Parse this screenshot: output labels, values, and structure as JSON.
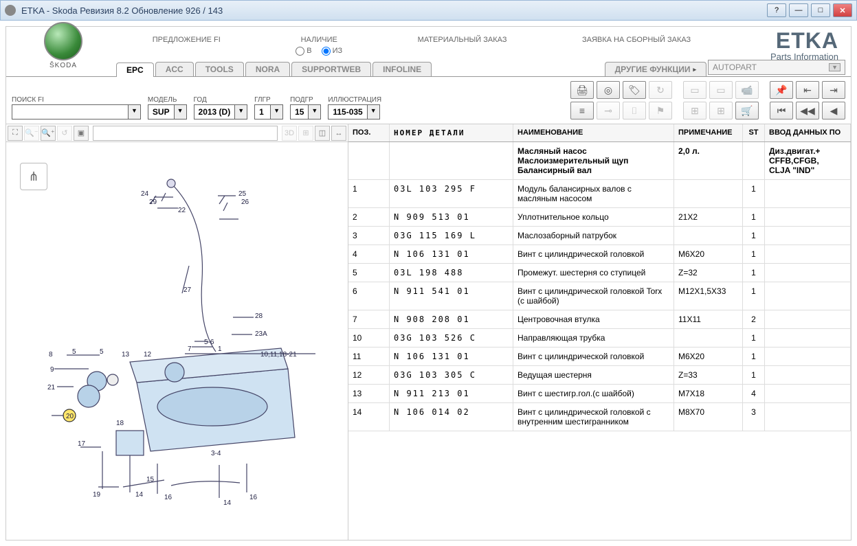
{
  "window": {
    "title": "ETKA - Skoda Ревизия 8.2 Обновление 926 / 143",
    "help": "?",
    "minimize": "—",
    "maximize": "□",
    "close": "✕"
  },
  "brand": {
    "label": "ŠKODA"
  },
  "topmenu": {
    "m1": "ПРЕДЛОЖЕНИЕ FI",
    "m2": "НАЛИЧИЕ",
    "m3": "МАТЕРИАЛЬНЫЙ ЗАКАЗ",
    "m4": "ЗАЯВКА НА СБОРНЫЙ ЗАКАЗ",
    "r1": "В",
    "r2": "ИЗ"
  },
  "etka": {
    "logo": "ETKA",
    "sub": "Parts Information"
  },
  "tabs": {
    "epc": "EPC",
    "acc": "ACC",
    "tools": "TOOLS",
    "nora": "NORA",
    "supportweb": "SUPPORTWEB",
    "infoline": "INFOLINE",
    "other": "ДРУГИЕ ФУНКЦИИ",
    "autopart": "AUTOPART"
  },
  "filters": {
    "search_lbl": "ПОИСК FI",
    "model_lbl": "МОДЕЛЬ",
    "model_val": "SUP",
    "year_lbl": "ГОД",
    "year_val": "2013 (D)",
    "gg_lbl": "ГЛГР",
    "gg_val": "1",
    "sg_lbl": "ПОДГР",
    "sg_val": "15",
    "ill_lbl": "ИЛЛЮСТРАЦИЯ",
    "ill_val": "115-035"
  },
  "imgtoolbar": {
    "threeD": "3D"
  },
  "columns": {
    "pos": "ПОЗ.",
    "num": "НОМЕР ДЕТАЛИ",
    "name": "НАИМЕНОВАНИЕ",
    "rem": "ПРИМЕЧАНИЕ",
    "st": "ST",
    "inp": "ВВОД ДАННЫХ ПО"
  },
  "headerrow": {
    "name": "Масляный насос\nМаслоизмерительный щуп\nБалансирный вал",
    "rem": "2,0 л.",
    "inp": "Диз.двигат.+\nCFFB,CFGB,\nCLJA \"IND\""
  },
  "rows": [
    {
      "pos": "1",
      "num": "03L 103 295 F",
      "name": "Модуль балансирных валов с масляным насосом",
      "rem": "",
      "st": "1"
    },
    {
      "pos": "2",
      "num": "N   909 513 01",
      "name": "Уплотнительное кольцо",
      "rem": "21X2",
      "st": "1"
    },
    {
      "pos": "3",
      "num": "03G 115 169 L",
      "name": "Маслозаборный патрубок",
      "rem": "",
      "st": "1"
    },
    {
      "pos": "4",
      "num": "N   106 131 01",
      "name": "Винт с цилиндрической головкой",
      "rem": "M6X20",
      "st": "1"
    },
    {
      "pos": "5",
      "num": "03L 198 488",
      "name": "Промежут. шестерня со ступицей",
      "rem": "Z=32",
      "st": "1"
    },
    {
      "pos": "6",
      "num": "N   911 541 01",
      "name": "Винт с цилиндрической головкой Torx (с шайбой)",
      "rem": "M12X1,5X33",
      "st": "1"
    },
    {
      "pos": "7",
      "num": "N   908 208 01",
      "name": "Центровочная втулка",
      "rem": "11X11",
      "st": "2"
    },
    {
      "pos": "10",
      "num": "03G 103 526 C",
      "name": "Направляющая трубка",
      "rem": "",
      "st": "1"
    },
    {
      "pos": "11",
      "num": "N   106 131 01",
      "name": "Винт с цилиндрической головкой",
      "rem": "M6X20",
      "st": "1"
    },
    {
      "pos": "12",
      "num": "03G 103 305 C",
      "name": "Ведущая шестерня",
      "rem": "Z=33",
      "st": "1"
    },
    {
      "pos": "13",
      "num": "N   911 213 01",
      "name": "Винт с шестигр.гол.(с шайбой)",
      "rem": "M7X18",
      "st": "4"
    },
    {
      "pos": "14",
      "num": "N   106 014 02",
      "name": "Винт с цилиндрической головкой с внутренним шестигранником",
      "rem": "M8X70",
      "st": "3"
    }
  ]
}
